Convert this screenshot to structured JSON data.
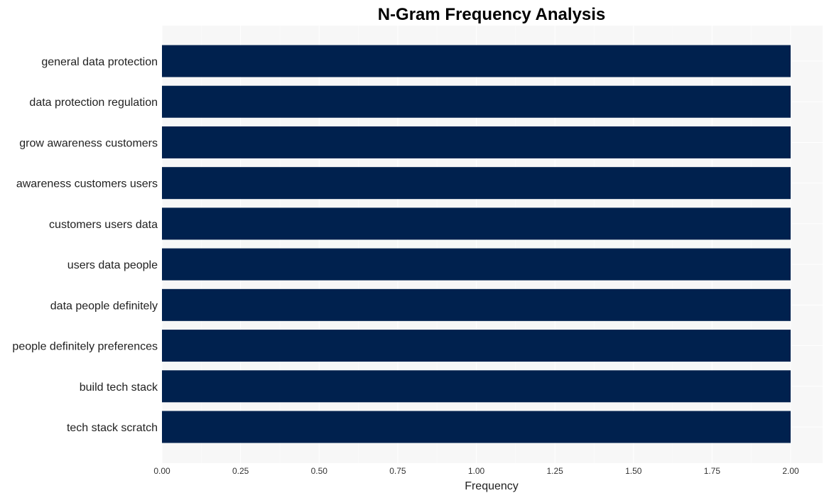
{
  "chart_data": {
    "type": "bar",
    "orientation": "horizontal",
    "title": "N-Gram Frequency Analysis",
    "xlabel": "Frequency",
    "ylabel": "",
    "categories": [
      "general data protection",
      "data protection regulation",
      "grow awareness customers",
      "awareness customers users",
      "customers users data",
      "users data people",
      "data people definitely",
      "people definitely preferences",
      "build tech stack",
      "tech stack scratch"
    ],
    "values": [
      2,
      2,
      2,
      2,
      2,
      2,
      2,
      2,
      2,
      2
    ],
    "xlim": [
      0,
      2.1
    ],
    "xticks": [
      "0.00",
      "0.25",
      "0.50",
      "0.75",
      "1.00",
      "1.25",
      "1.50",
      "1.75",
      "2.00"
    ],
    "grid": true,
    "legend": "none",
    "colors": {
      "bar": "#00214e",
      "plot_background": "#f7f7f7",
      "grid": "#ffffff"
    }
  }
}
